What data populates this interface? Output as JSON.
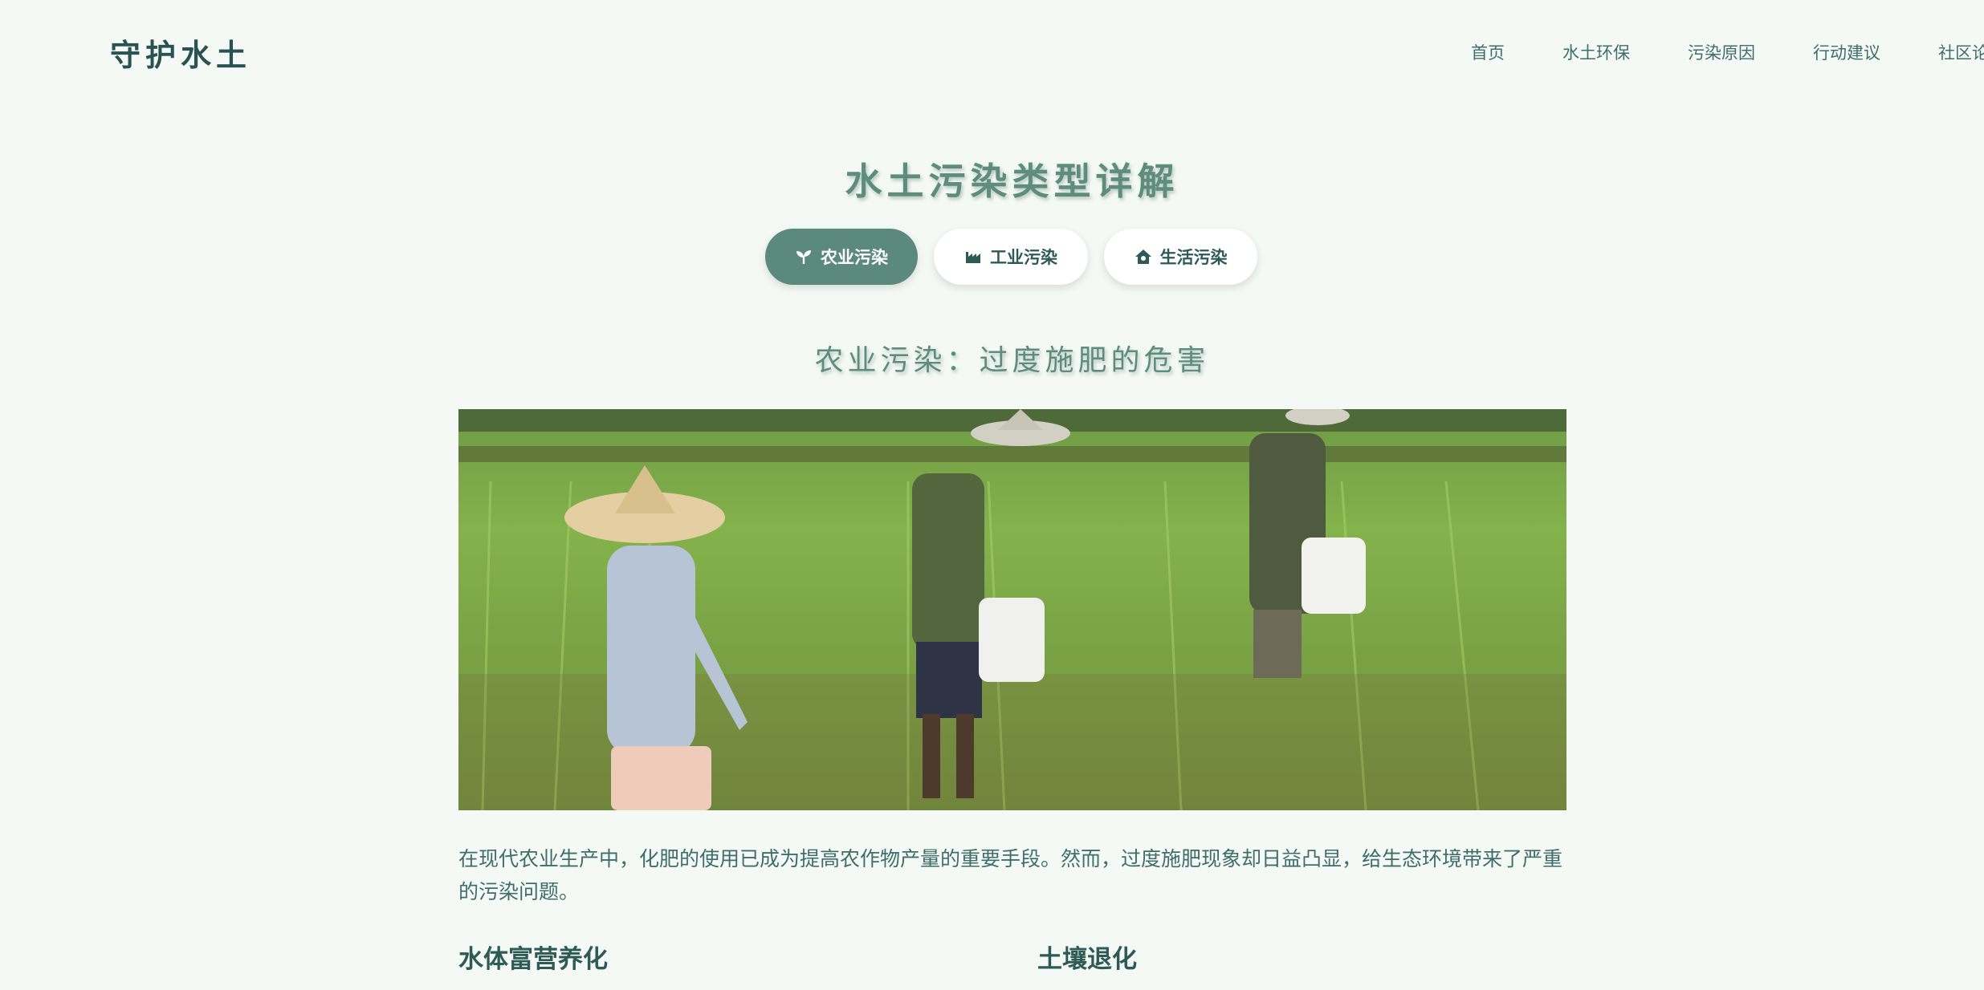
{
  "brand": {
    "logo_text": "守护水土"
  },
  "nav": {
    "items": [
      {
        "label": "首页"
      },
      {
        "label": "水土环保"
      },
      {
        "label": "污染原因"
      },
      {
        "label": "行动建议"
      },
      {
        "label": "社区论坛"
      }
    ]
  },
  "page": {
    "title": "水土污染类型详解"
  },
  "tabs": [
    {
      "label": "农业污染",
      "icon": "seedling-icon",
      "active": true
    },
    {
      "label": "工业污染",
      "icon": "industry-icon",
      "active": false
    },
    {
      "label": "生活污染",
      "icon": "house-icon",
      "active": false
    }
  ],
  "section": {
    "title": "农业污染：过度施肥的危害",
    "intro": "在现代农业生产中，化肥的使用已成为提高农作物产量的重要手段。然而，过度施肥现象却日益凸显，给生态环境带来了严重的污染问题。",
    "subheadings": [
      "水体富营养化",
      "土壤退化"
    ]
  },
  "colors": {
    "background": "#f4f9f6",
    "accent": "#5b8a7c",
    "text": "#2e5a55"
  }
}
